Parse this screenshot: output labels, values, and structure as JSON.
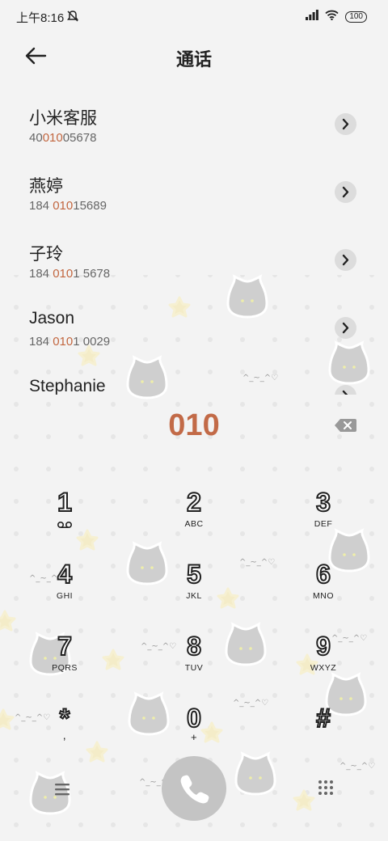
{
  "status_bar": {
    "time": "上午8:16",
    "battery": "100"
  },
  "header": {
    "title": "通话"
  },
  "contacts": [
    {
      "name": "小米客服",
      "number_before": "40",
      "number_match": "010",
      "number_after": "05678"
    },
    {
      "name": "燕婷",
      "number_before": "184 ",
      "number_match": "010",
      "number_after": "15689"
    },
    {
      "name": "子玲",
      "number_before": "184 ",
      "number_match": "010",
      "number_after": "1 5678"
    },
    {
      "name": "Jason",
      "number_before": "184 ",
      "number_match": "010",
      "number_after": "1 0029"
    },
    {
      "name": "Stephanie",
      "number_before": "",
      "number_match": "",
      "number_after": ""
    }
  ],
  "dial_input": "010",
  "keypad": [
    {
      "digit": "1",
      "letters": ""
    },
    {
      "digit": "2",
      "letters": "ABC"
    },
    {
      "digit": "3",
      "letters": "DEF"
    },
    {
      "digit": "4",
      "letters": "GHI"
    },
    {
      "digit": "5",
      "letters": "JKL"
    },
    {
      "digit": "6",
      "letters": "MNO"
    },
    {
      "digit": "7",
      "letters": "PQRS"
    },
    {
      "digit": "8",
      "letters": "TUV"
    },
    {
      "digit": "9",
      "letters": "WXYZ"
    },
    {
      "digit": "*",
      "letters": ","
    },
    {
      "digit": "0",
      "letters": "+"
    },
    {
      "digit": "#",
      "letters": ""
    }
  ],
  "decor_face": "^_~_^♡",
  "colors": {
    "highlight": "#c2663f",
    "call_button": "#c4c4c4",
    "background": "#f3f3f3"
  },
  "icons": [
    "back-arrow-icon",
    "chevron-right-icon",
    "backspace-icon",
    "voicemail-icon",
    "menu-icon",
    "phone-icon",
    "dialpad-icon",
    "signal-icon",
    "wifi-icon",
    "mute-icon"
  ]
}
